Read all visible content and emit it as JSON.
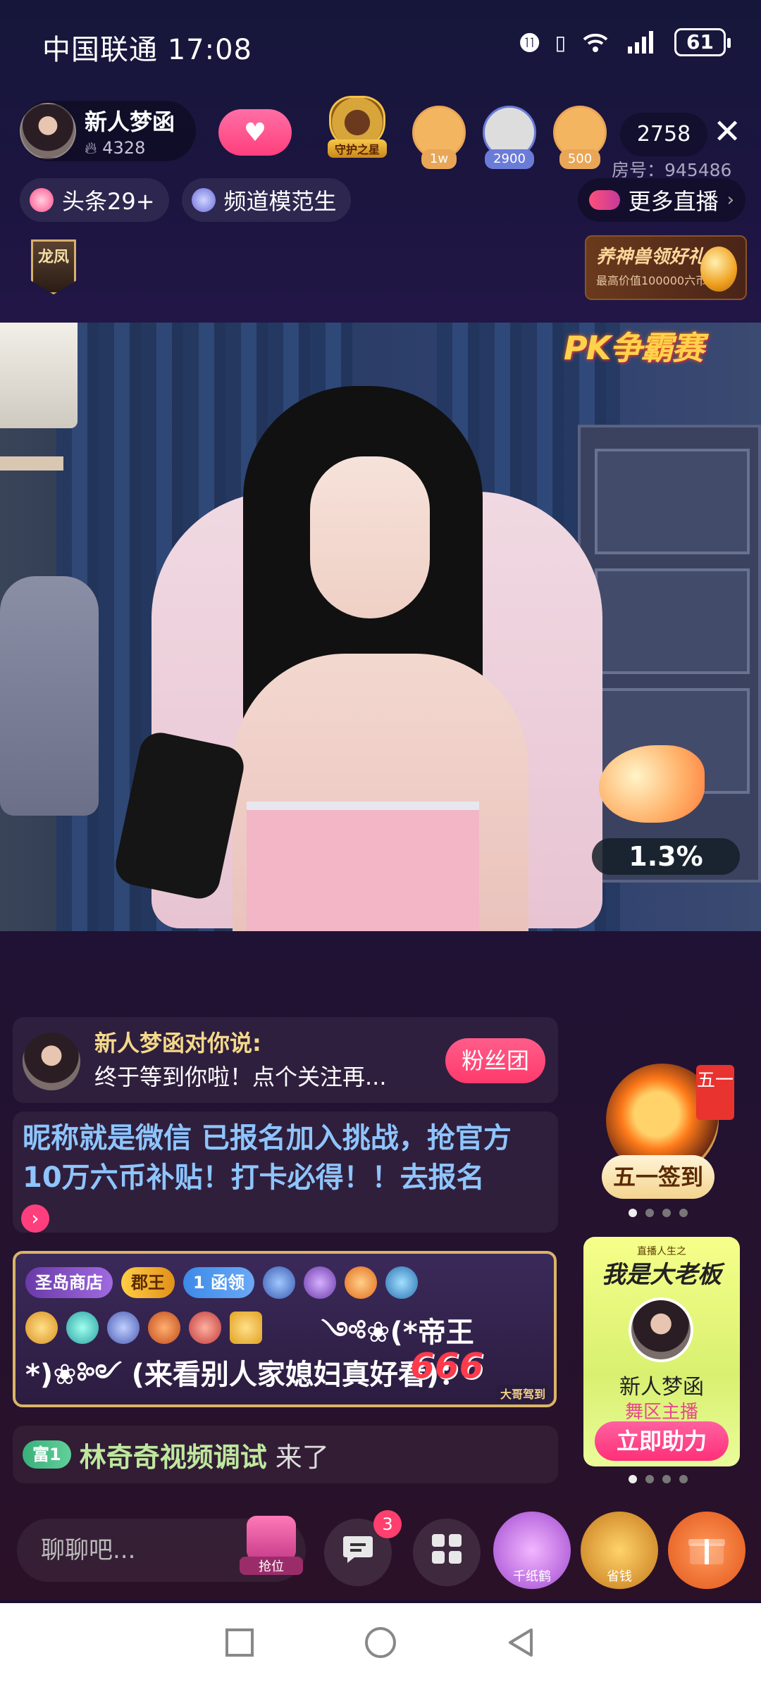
{
  "status_bar": {
    "carrier_time": "中国联通 17:08",
    "icons": [
      "nfc-icon",
      "vibrate-icon",
      "wifi-icon",
      "signal-4g-icon"
    ],
    "battery": "61"
  },
  "header": {
    "streamer_name": "新人梦函",
    "streamer_heat": "4328",
    "guard_label": "守护之星",
    "viewers": [
      {
        "count": "1w",
        "color": "#e9a657"
      },
      {
        "count": "2900",
        "color": "#6a7bd8"
      },
      {
        "count": "500",
        "color": "#e9a657"
      }
    ],
    "online_count": "2758",
    "room_no": "房号：945486",
    "pills": [
      {
        "label": "头条29+",
        "icon": "flame-icon"
      },
      {
        "label": "频道模范生",
        "icon": "ribbon-icon"
      }
    ],
    "more_live": "更多直播",
    "dragon_badge": "龙凤",
    "gift_banner_title": "养神兽领好礼",
    "gift_banner_sub": "最高价值100000六币"
  },
  "video": {
    "pk_logo": "PK争霸赛",
    "progress_percent": "1.3%"
  },
  "chat": {
    "follow_title": "新人梦函对你说:",
    "follow_msg": "终于等到你啦！点个关注再...",
    "fan_button": "粉丝团",
    "notice_text": "昵称就是微信 已报名加入挑战，抢官方10万六币补贴！打卡必得！！去报名",
    "vip": {
      "shop_badge": "圣岛商店",
      "king_badge": "郡王",
      "level_badge": "1",
      "han_badge": "函领",
      "message": "༺❀(*帝王*)❀༻ (来看别人家媳妇真好看)",
      "colon": "：",
      "emote": "666",
      "tag": "大哥驾到"
    },
    "join": {
      "rich_badge": "富1",
      "name": "林奇奇视频调试",
      "suffix": "来了"
    }
  },
  "side": {
    "sign_flag": "五一",
    "sign_label": "五一签到",
    "boss_top": "直播人生之",
    "boss_title": "我是大老板",
    "boss_name": "新人梦函",
    "boss_zone": "舞区主播",
    "boss_button": "立即助力"
  },
  "bottom": {
    "chat_placeholder": "聊聊吧...",
    "seat_label": "抢位",
    "message_badge": "3",
    "crane_label": "千纸鹤",
    "save_label": "省钱"
  }
}
